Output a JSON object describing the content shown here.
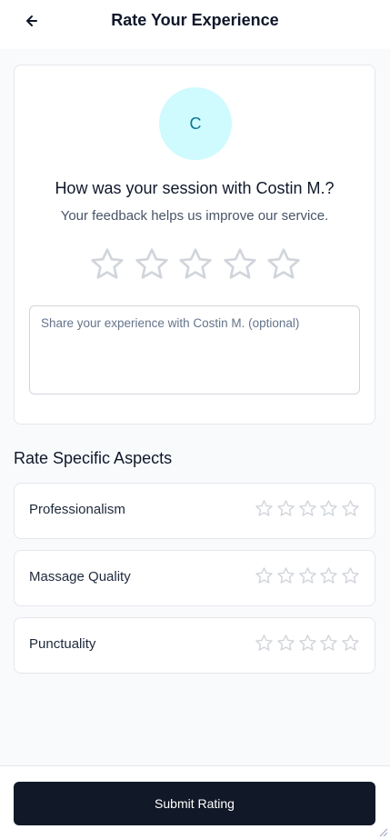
{
  "header": {
    "title": "Rate Your Experience",
    "back_icon": "arrow-left-icon"
  },
  "main": {
    "avatar_initial": "C",
    "question": "How was your session with Costin M.?",
    "subtext": "Your feedback helps us improve our service.",
    "overall_rating": 0,
    "max_rating": 5,
    "feedback_placeholder": "Share your experience with Costin M. (optional)",
    "feedback_value": ""
  },
  "aspects": {
    "title": "Rate Specific Aspects",
    "items": [
      {
        "label": "Professionalism",
        "rating": 0
      },
      {
        "label": "Massage Quality",
        "rating": 0
      },
      {
        "label": "Punctuality",
        "rating": 0
      }
    ]
  },
  "footer": {
    "submit_label": "Submit Rating"
  },
  "colors": {
    "avatar_bg": "#cffafe",
    "avatar_text": "#0e7490",
    "star_outline": "#d1d5db",
    "button_bg": "#111827"
  }
}
